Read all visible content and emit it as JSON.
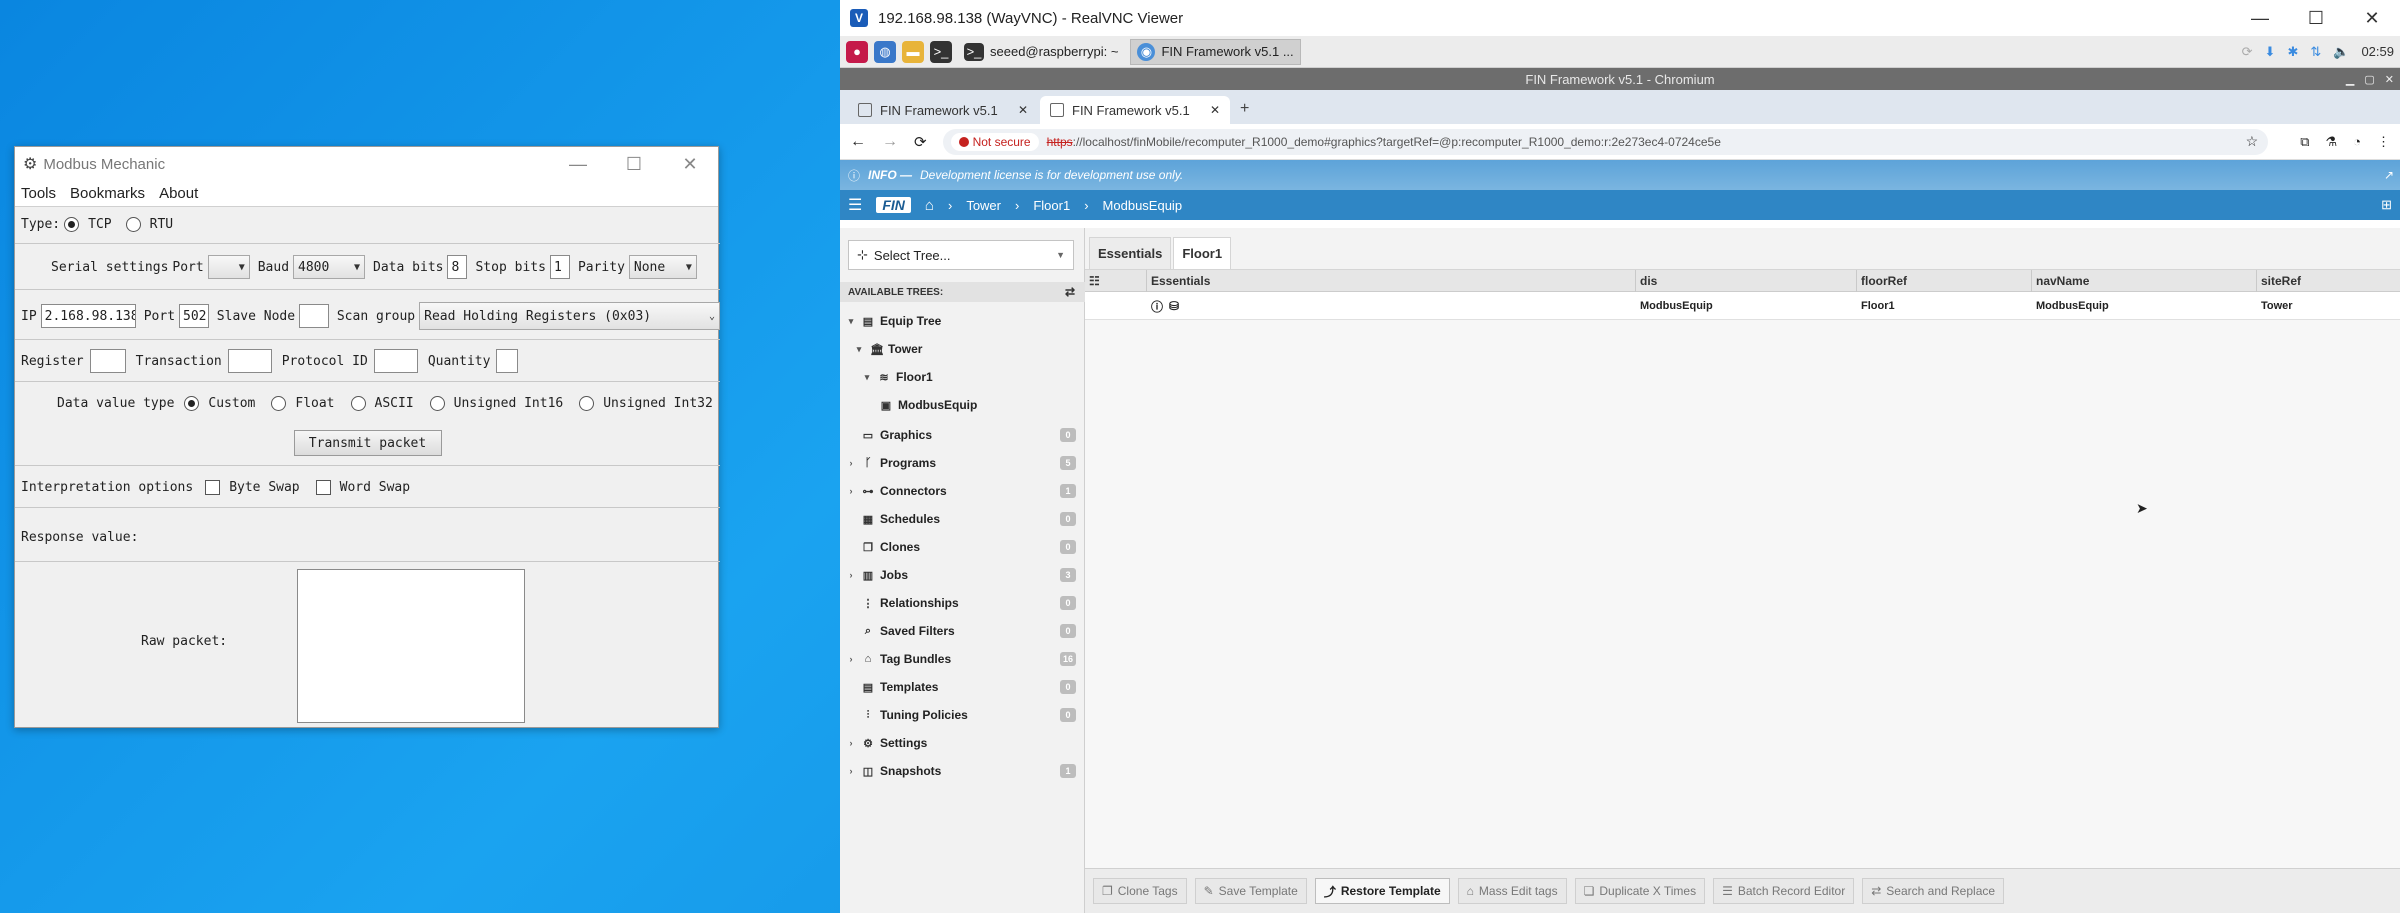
{
  "modbus": {
    "title": "Modbus Mechanic",
    "menu": [
      "Tools",
      "Bookmarks",
      "About"
    ],
    "type_label": "Type:",
    "type_options": [
      "TCP",
      "RTU"
    ],
    "serial_label": "Serial settings",
    "port_label": "Port",
    "port_value": "",
    "baud_label": "Baud",
    "baud_value": "4800",
    "databits_label": "Data bits",
    "databits_value": "8",
    "stopbits_label": "Stop bits",
    "stopbits_value": "1",
    "parity_label": "Parity",
    "parity_value": "None",
    "ip_label": "IP",
    "ip_value": "2.168.98.138",
    "tcp_port_label": "Port",
    "tcp_port_value": "502",
    "slave_label": "Slave Node",
    "slave_value": "",
    "scan_label": "Scan group",
    "scan_value": "Read Holding Registers (0x03)",
    "register_label": "Register",
    "transaction_label": "Transaction",
    "protocol_label": "Protocol ID",
    "quantity_label": "Quantity",
    "dvt_label": "Data value type",
    "dvt_options": [
      "Custom",
      "Float",
      "ASCII",
      "Unsigned Int16",
      "Unsigned Int32"
    ],
    "transmit_label": "Transmit packet",
    "interp_label": "Interpretation options",
    "byte_swap": "Byte Swap",
    "word_swap": "Word Swap",
    "response_label": "Response value:",
    "raw_label": "Raw packet:"
  },
  "vnc": {
    "title": "192.168.98.138 (WayVNC) - RealVNC Viewer",
    "taskbar": {
      "terminal_task": "seeed@raspberrypi: ~",
      "chromium_task": "FIN Framework v5.1 ...",
      "clock": "02:59"
    },
    "chromium_title": "FIN Framework v5.1 - Chromium",
    "tabs": [
      "FIN Framework v5.1",
      "FIN Framework v5.1"
    ],
    "not_secure": "Not secure",
    "url_scheme": "https",
    "url_rest": "://localhost/finMobile/recomputer_R1000_demo#graphics?targetRef=@p:recomputer_R1000_demo:r:2e273ec4-0724ce5e",
    "info_bold": "INFO —",
    "info_text": "Development license is for development use only.",
    "logo": "FIN",
    "breadcrumb": [
      "Tower",
      "Floor1",
      "ModbusEquip"
    ]
  },
  "sidebar": {
    "select_tree": "Select Tree...",
    "available": "AVAILABLE TREES:",
    "items": [
      {
        "label": "Equip Tree",
        "count": ""
      },
      {
        "label": "Tower",
        "count": ""
      },
      {
        "label": "Floor1",
        "count": ""
      },
      {
        "label": "ModbusEquip",
        "count": ""
      },
      {
        "label": "Graphics",
        "count": "0"
      },
      {
        "label": "Programs",
        "count": "5"
      },
      {
        "label": "Connectors",
        "count": "1"
      },
      {
        "label": "Schedules",
        "count": "0"
      },
      {
        "label": "Clones",
        "count": "0"
      },
      {
        "label": "Jobs",
        "count": "3"
      },
      {
        "label": "Relationships",
        "count": "0"
      },
      {
        "label": "Saved Filters",
        "count": "0"
      },
      {
        "label": "Tag Bundles",
        "count": "16"
      },
      {
        "label": "Templates",
        "count": "0"
      },
      {
        "label": "Tuning Policies",
        "count": "0"
      },
      {
        "label": "Settings",
        "count": ""
      },
      {
        "label": "Snapshots",
        "count": "1"
      }
    ]
  },
  "main": {
    "tabs": [
      "Essentials",
      "Floor1"
    ],
    "columns": [
      "Essentials",
      "dis",
      "floorRef",
      "navName",
      "siteRef"
    ],
    "row": {
      "dis": "ModbusEquip",
      "floorRef": "Floor1",
      "navName": "ModbusEquip",
      "siteRef": "Tower"
    },
    "buttons": [
      "Clone Tags",
      "Save Template",
      "Restore Template",
      "Mass Edit tags",
      "Duplicate X Times",
      "Batch Record Editor",
      "Search and Replace"
    ]
  }
}
